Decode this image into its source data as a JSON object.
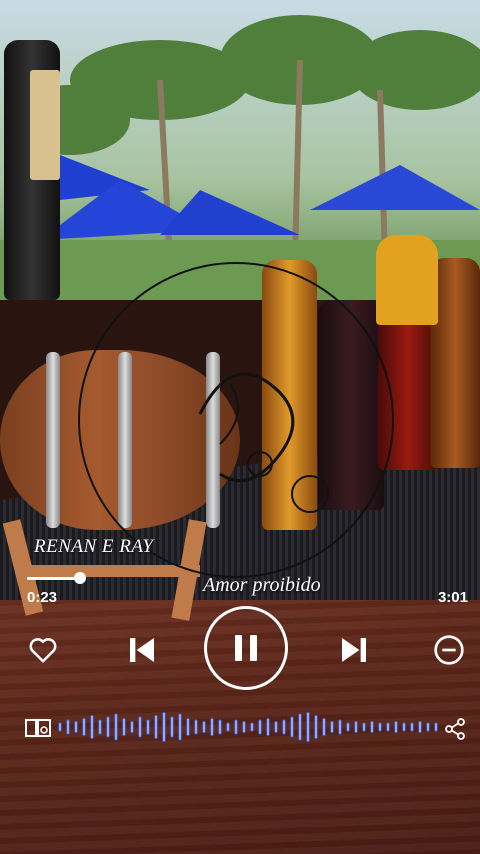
{
  "player": {
    "artist": "RENAN E RAY",
    "title": "Amor proibido",
    "elapsed": "0:23",
    "duration": "3:01",
    "progress_fraction": 0.127
  },
  "controls": {
    "like_icon": "heart-outline-icon",
    "prev_icon": "skip-previous-icon",
    "play_pause_icon": "pause-icon",
    "next_icon": "skip-next-icon",
    "remove_icon": "minus-circle-icon",
    "device_icon": "speaker-device-icon",
    "share_icon": "share-icon"
  },
  "equalizer": {
    "accent_color": "#3b6cff",
    "levels": [
      0.3,
      0.5,
      0.4,
      0.6,
      0.8,
      0.5,
      0.7,
      0.9,
      0.6,
      0.4,
      0.7,
      0.5,
      0.8,
      1.0,
      0.7,
      0.9,
      0.6,
      0.5,
      0.4,
      0.6,
      0.5,
      0.3,
      0.5,
      0.4,
      0.3,
      0.5,
      0.6,
      0.4,
      0.5,
      0.7,
      0.9,
      1.0,
      0.8,
      0.6,
      0.4,
      0.5,
      0.3,
      0.4,
      0.3,
      0.4,
      0.3,
      0.3,
      0.4,
      0.3,
      0.3,
      0.4,
      0.3,
      0.3
    ]
  }
}
